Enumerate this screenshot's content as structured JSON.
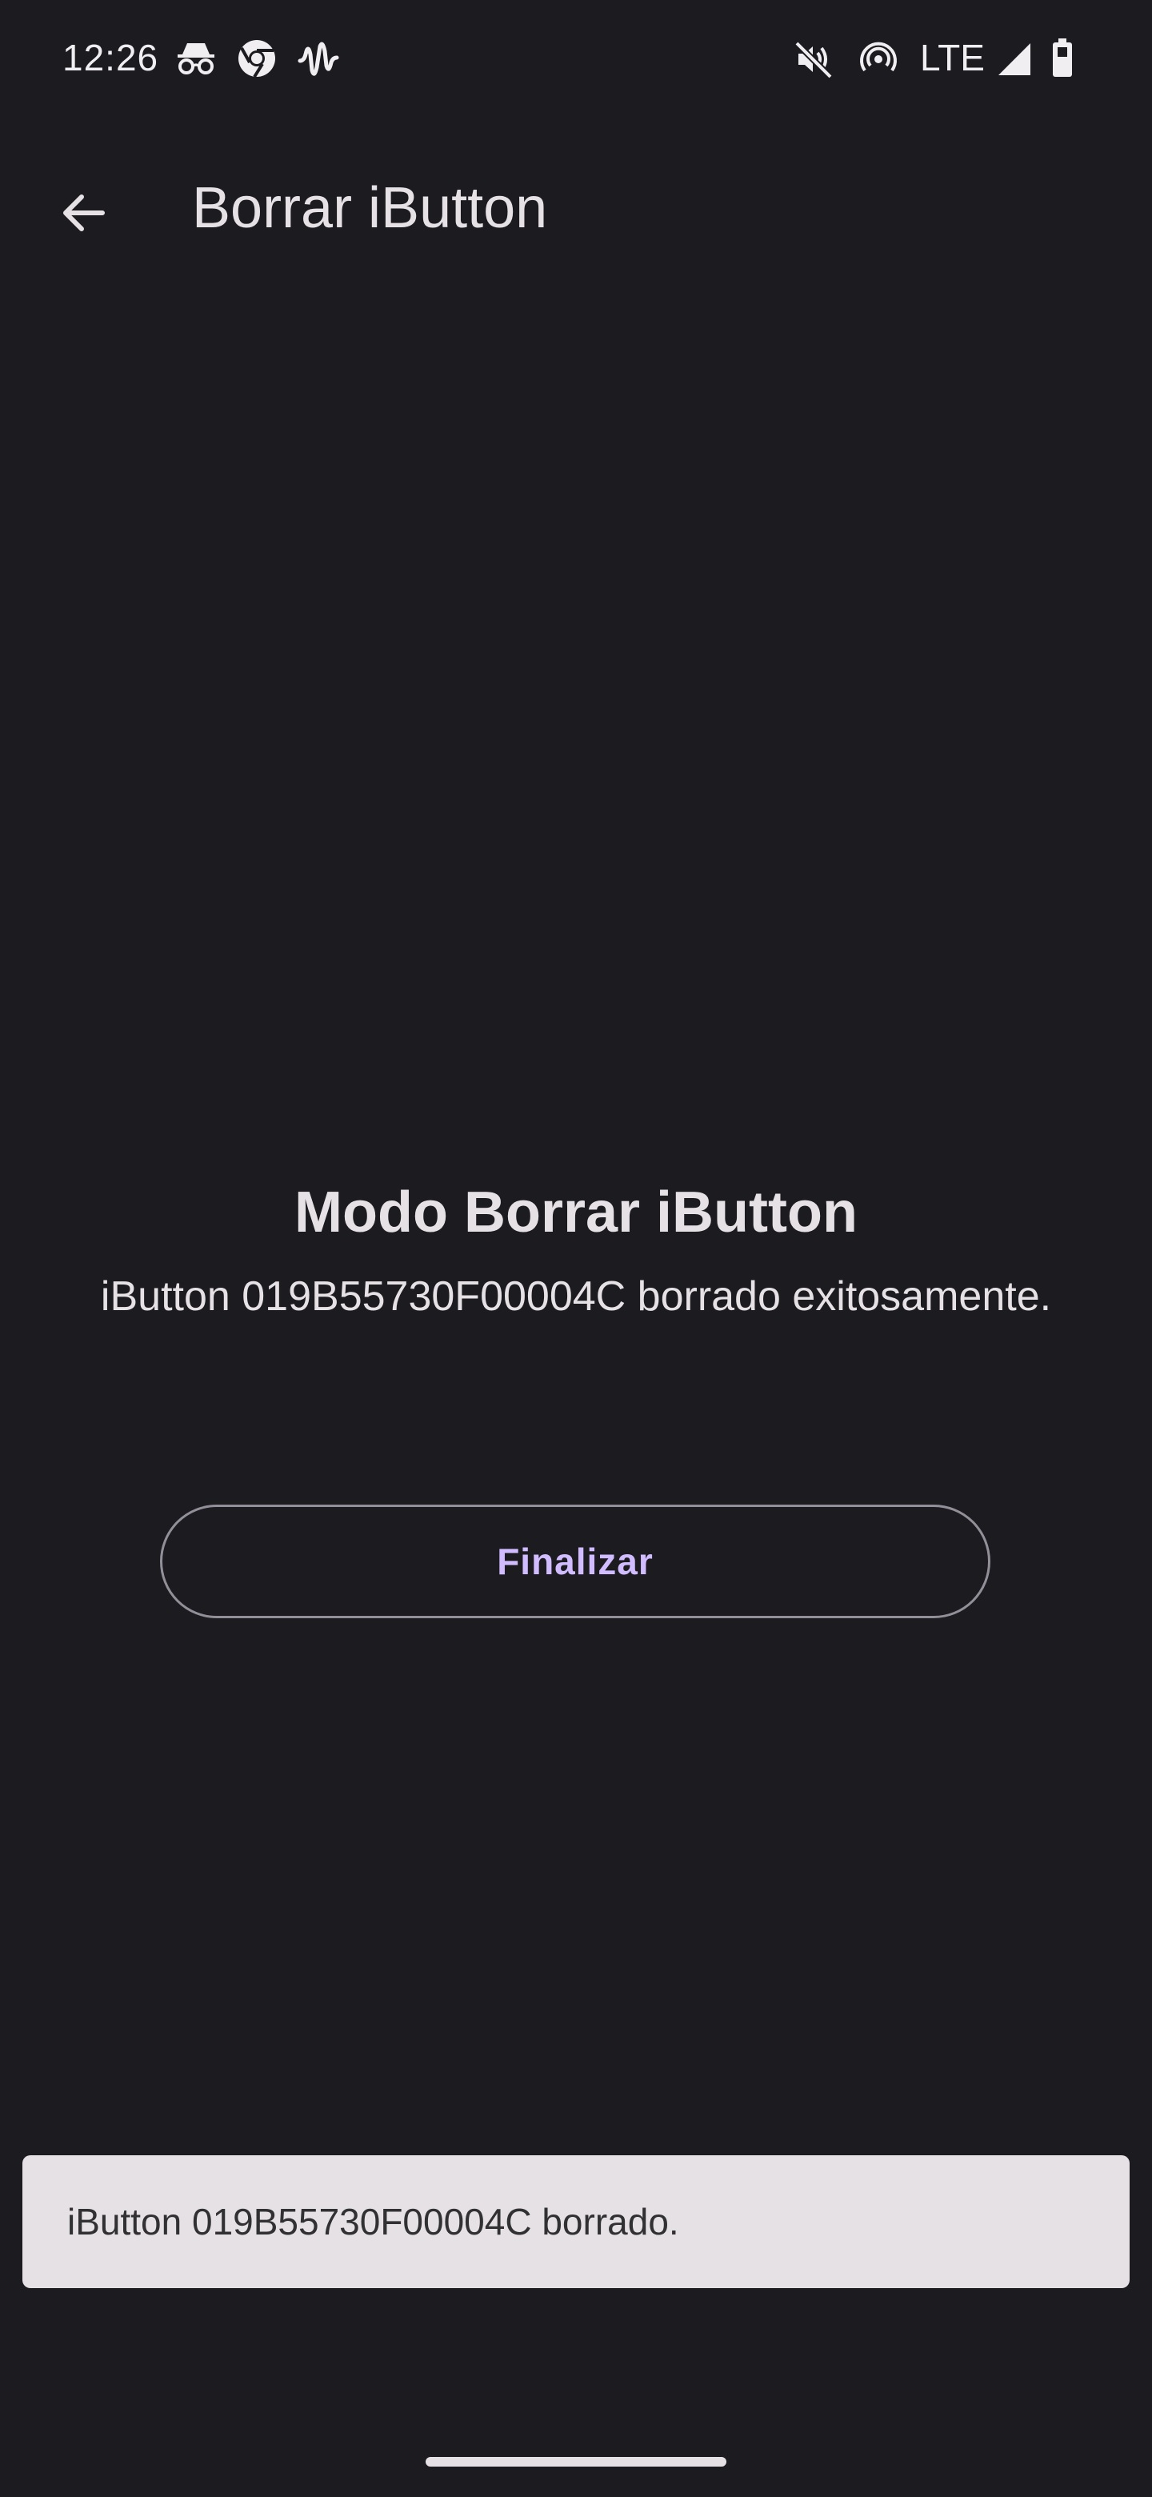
{
  "status_bar": {
    "time": "12:26",
    "network": "LTE",
    "icons": [
      "incognito-icon",
      "chrome-icon",
      "waveform-icon",
      "mute-vibrate-icon",
      "hotspot-icon",
      "signal-icon",
      "battery-icon"
    ]
  },
  "app_bar": {
    "title": "Borrar iButton",
    "back_icon": "arrow-back-icon"
  },
  "main": {
    "title": "Modo Borrar iButton",
    "message": "iButton 019B55730F00004C borrado exitosamente.",
    "finish_button_label": "Finalizar"
  },
  "snackbar": {
    "message": "iButton 019B55730F00004C borrado."
  },
  "colors": {
    "background": "#1c1b20",
    "on_surface": "#e6e1e5",
    "primary": "#d0bcff",
    "outline": "#938f99",
    "snackbar_bg": "#e6e1e5",
    "snackbar_text": "#313033"
  }
}
